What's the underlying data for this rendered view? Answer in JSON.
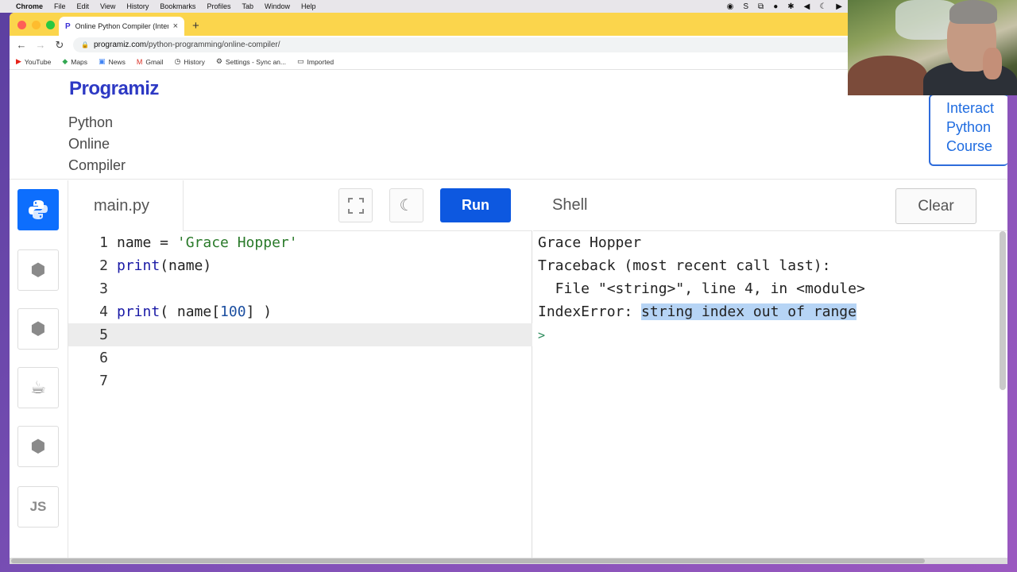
{
  "menubar": {
    "app": "Chrome",
    "items": [
      "File",
      "Edit",
      "View",
      "History",
      "Bookmarks",
      "Profiles",
      "Tab",
      "Window",
      "Help"
    ]
  },
  "browser": {
    "tab_title": "Online Python Compiler (Interp",
    "url_domain": "programiz.com",
    "url_path": "/python-programming/online-compiler/",
    "bookmarks": [
      "YouTube",
      "Maps",
      "News",
      "Gmail",
      "History",
      "Settings - Sync an...",
      "Imported"
    ]
  },
  "header": {
    "logo": "Programiz",
    "subtitle_lines": [
      "Python",
      "Online",
      "Compiler"
    ],
    "course_lines": [
      "Interact",
      "Python",
      "Course"
    ]
  },
  "sidebar": {
    "languages": [
      "python-icon",
      "c-icon",
      "cpp-icon",
      "java-icon",
      "csharp-icon",
      "js-icon"
    ],
    "js_label": "JS"
  },
  "editor": {
    "filename": "main.py",
    "run_label": "Run",
    "line_numbers": [
      "1",
      "2",
      "3",
      "4",
      "5",
      "6",
      "7"
    ],
    "lines": [
      {
        "parts": [
          {
            "t": "name = ",
            "c": ""
          },
          {
            "t": "'Grace Hopper'",
            "c": "str"
          }
        ]
      },
      {
        "parts": [
          {
            "t": "print",
            "c": "kw"
          },
          {
            "t": "(name)",
            "c": ""
          }
        ]
      },
      {
        "parts": []
      },
      {
        "parts": [
          {
            "t": "print",
            "c": "kw"
          },
          {
            "t": "( name[",
            "c": ""
          },
          {
            "t": "100",
            "c": "num"
          },
          {
            "t": "] )",
            "c": ""
          }
        ]
      },
      {
        "parts": []
      },
      {
        "parts": []
      },
      {
        "parts": []
      }
    ],
    "active_line": 5
  },
  "shell": {
    "title": "Shell",
    "clear_label": "Clear",
    "output": {
      "line1": "Grace Hopper",
      "line2": "Traceback (most recent call last):",
      "line3": "  File \"<string>\", line 4, in <module>",
      "line4_prefix": "IndexError: ",
      "line4_selected": "string index out of range",
      "prompt": ">"
    }
  }
}
